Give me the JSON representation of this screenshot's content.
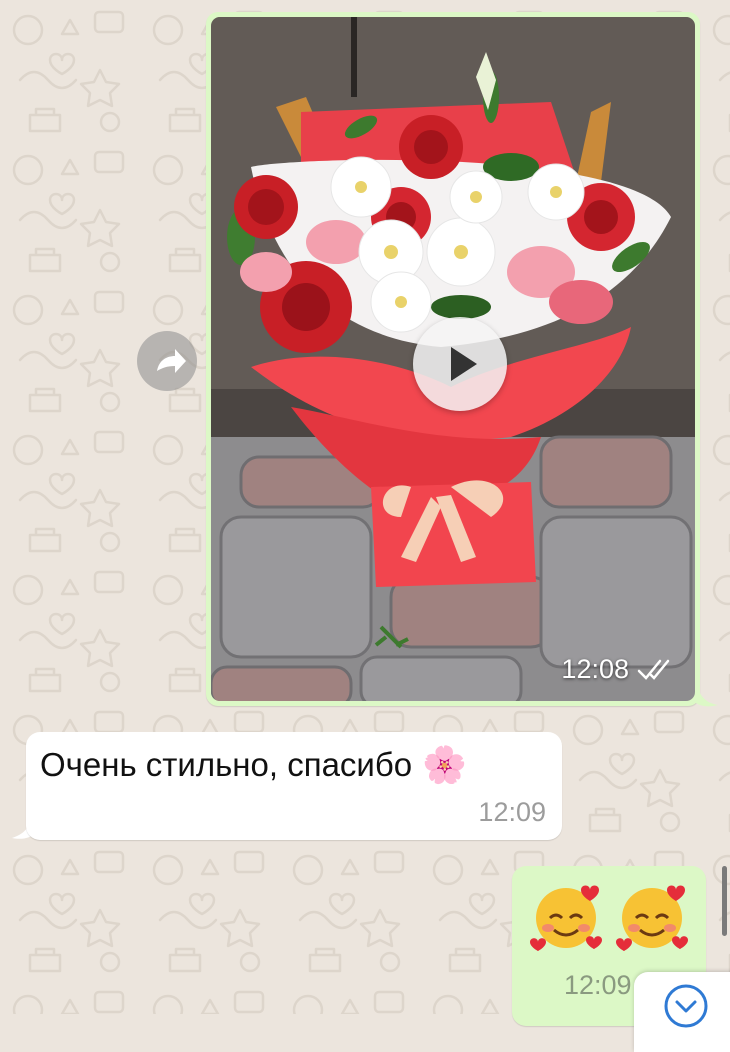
{
  "colors": {
    "chat_background": "#ece5dd",
    "outgoing_bubble": "#dcf8c6",
    "incoming_bubble": "#ffffff",
    "timestamp_gray": "#9c9c9c",
    "read_ticks": "#ffffff"
  },
  "chat": {
    "messages": [
      {
        "direction": "outgoing",
        "type": "video",
        "thumbnail_subject": "bouquet of red roses, white daisies and pink alstroemeria in red wrapping",
        "time": "12:08",
        "status": "read",
        "icons": [
          "play-icon",
          "double-check-icon"
        ]
      },
      {
        "direction": "incoming",
        "type": "text",
        "text": "Очень стильно, спасибо",
        "emoji": "🌸",
        "time": "12:09"
      },
      {
        "direction": "outgoing",
        "type": "emoji",
        "emoji": [
          "🥰",
          "🥰"
        ],
        "time": "12:09"
      }
    ],
    "forward_button_icon": "forward-arrow-icon",
    "scroll_down_icon": "chevron-down-icon"
  }
}
